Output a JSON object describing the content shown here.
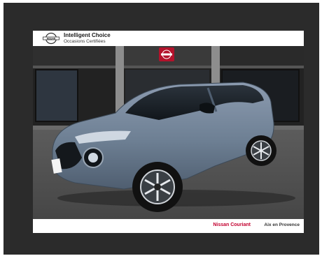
{
  "brand": {
    "title": "Intelligent Choice",
    "subtitle": "Occasions Certifiées",
    "logo_text": "NISSAN"
  },
  "footer": {
    "dealer": "Nissan Couriant",
    "location": "Aix en Provence"
  },
  "photo": {
    "subject": "car-photo",
    "car_color": "#6d7f93",
    "background_color": "#1f1f1f"
  }
}
